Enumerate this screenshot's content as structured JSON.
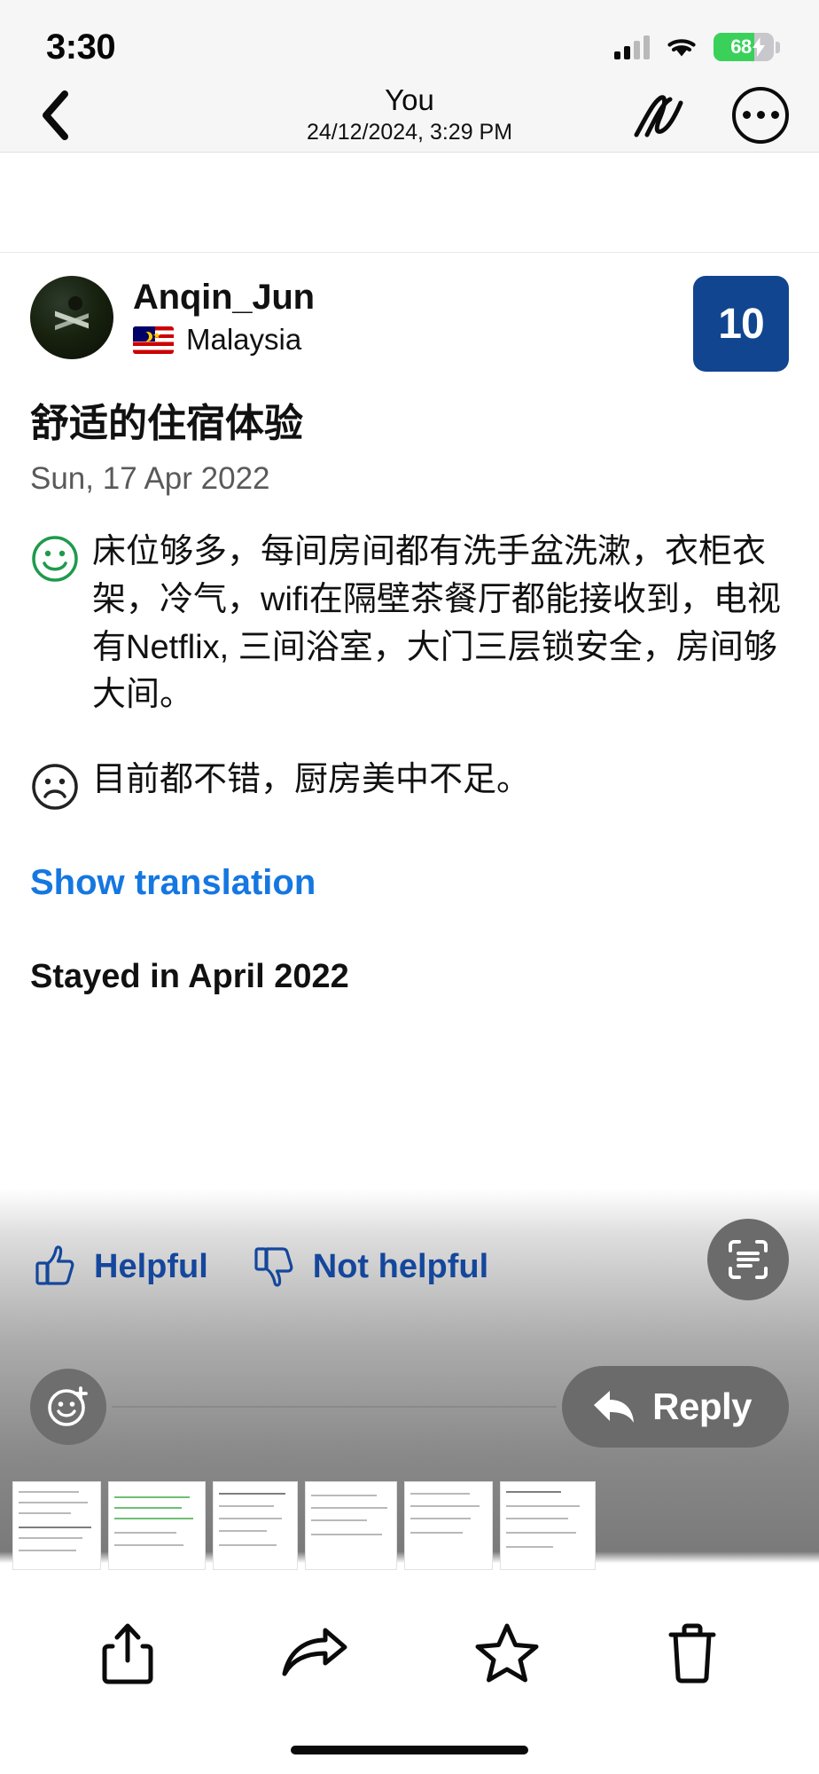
{
  "status_bar": {
    "time": "3:30",
    "battery_percent": "68",
    "battery_level": 68,
    "icons": [
      "cellular-signal-icon",
      "wifi-icon",
      "battery-charging-icon"
    ]
  },
  "nav_bar": {
    "back_icon": "chevron-left-icon",
    "title": "You",
    "subtitle": "24/12/2024, 3:29 PM",
    "markup_icon": "squiggle-markup-icon",
    "more_icon": "more-options-icon"
  },
  "review": {
    "avatar": "user-avatar",
    "username": "Anqin_Jun",
    "country_flag": "malaysia-flag-icon",
    "country": "Malaysia",
    "score": "10",
    "score_color": "#11458f",
    "title": "舒适的住宿体验",
    "date": "Sun, 17 Apr 2022",
    "positive_icon": "smiley-face-icon",
    "positive_color": "#1f9a4d",
    "positive_text": "床位够多，每间房间都有洗手盆洗漱，衣柜衣架，冷气，wifi在隔壁茶餐厅都能接收到，电视有Netflix, 三间浴室，大门三层锁安全，房间够大间。",
    "negative_icon": "frowning-face-icon",
    "negative_text": "目前都不错，厨房美中不足。",
    "show_translation": "Show translation",
    "translation_link_color": "#1577e0",
    "stayed": "Stayed in April 2022"
  },
  "feedback": {
    "helpful_label": "Helpful",
    "helpful_icon": "thumbs-up-icon",
    "not_helpful_label": "Not helpful",
    "not_helpful_icon": "thumbs-down-icon",
    "link_color": "#14479c",
    "scan_icon": "live-text-scan-icon"
  },
  "reply_bar": {
    "emoji_icon": "add-reaction-icon",
    "reply_label": "Reply",
    "reply_icon": "reply-arrow-icon"
  },
  "bottom_bar": {
    "actions": [
      {
        "name": "share-icon",
        "label": "Share"
      },
      {
        "name": "forward-arrow-icon",
        "label": "Forward"
      },
      {
        "name": "star-icon",
        "label": "Favorite"
      },
      {
        "name": "trash-icon",
        "label": "Delete"
      }
    ]
  },
  "thumbnails": [
    {
      "name": "document-thumbnail-1"
    },
    {
      "name": "document-thumbnail-2"
    },
    {
      "name": "document-thumbnail-3"
    },
    {
      "name": "document-thumbnail-4"
    },
    {
      "name": "document-thumbnail-5"
    },
    {
      "name": "document-thumbnail-6"
    }
  ]
}
